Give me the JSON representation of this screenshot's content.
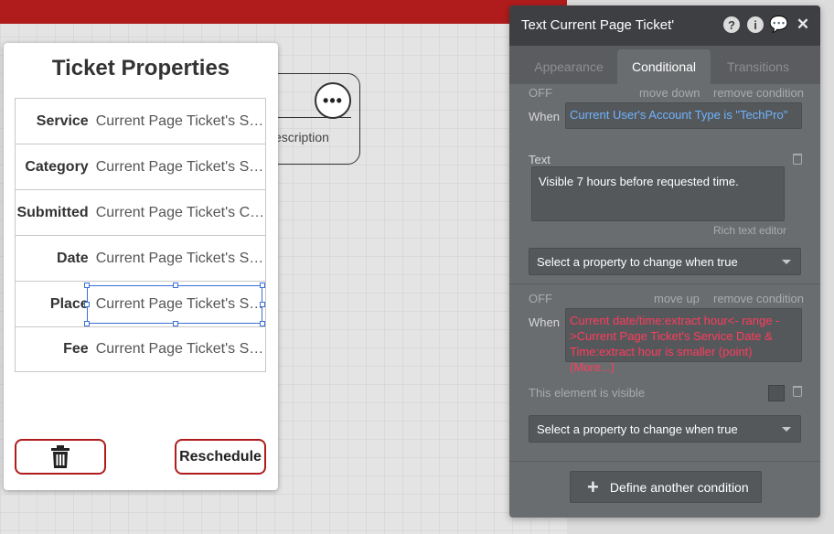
{
  "canvas": {
    "background_text": "escription",
    "more_icon": "ellipsis-icon"
  },
  "popup": {
    "title": "Ticket Properties",
    "rows": [
      {
        "label": "Service",
        "value": "Current Page Ticket's Se..."
      },
      {
        "label": "Category",
        "value": "Current Page Ticket's Se..."
      },
      {
        "label": "Submitted",
        "value": "Current Page Ticket's Cr..."
      },
      {
        "label": "Date",
        "value": "Current Page Ticket's Se..."
      },
      {
        "label": "Place",
        "value": "Current Page Ticket's Se..."
      },
      {
        "label": "Fee",
        "value": "Current Page Ticket's Se..."
      }
    ],
    "delete_icon": "trash-icon",
    "reschedule_label": "Reschedule",
    "accent_color": "#b01c1c"
  },
  "panel": {
    "title": "Text Current Page Ticket'",
    "header_icons": [
      "help-icon",
      "info-icon",
      "comment-icon",
      "close-icon"
    ],
    "tabs": [
      "Appearance",
      "Conditional",
      "Transitions"
    ],
    "active_tab": "Conditional",
    "condition1": {
      "status": "OFF",
      "move_label": "move down",
      "remove_label": "remove condition",
      "when_label": "When",
      "expression": "Current User's Account Type is \"TechPro\"",
      "expression_color": "#6fb3ff",
      "property_label": "Text",
      "text_value": "Visible 7 hours before requested time.",
      "rich_text_label": "Rich text editor",
      "select_placeholder": "Select a property to change when true"
    },
    "condition2": {
      "status": "OFF",
      "move_label": "move up",
      "remove_label": "remove condition",
      "when_label": "When",
      "expression": "Current date/time:extract hour<- range ->Current Page Ticket's Service Date & Time:extract hour is smaller (point) (More...)",
      "expression_color": "#ff3b5c",
      "visible_label": "This element is visible",
      "select_placeholder": "Select a property to change when true"
    },
    "define_label": "Define another condition"
  }
}
